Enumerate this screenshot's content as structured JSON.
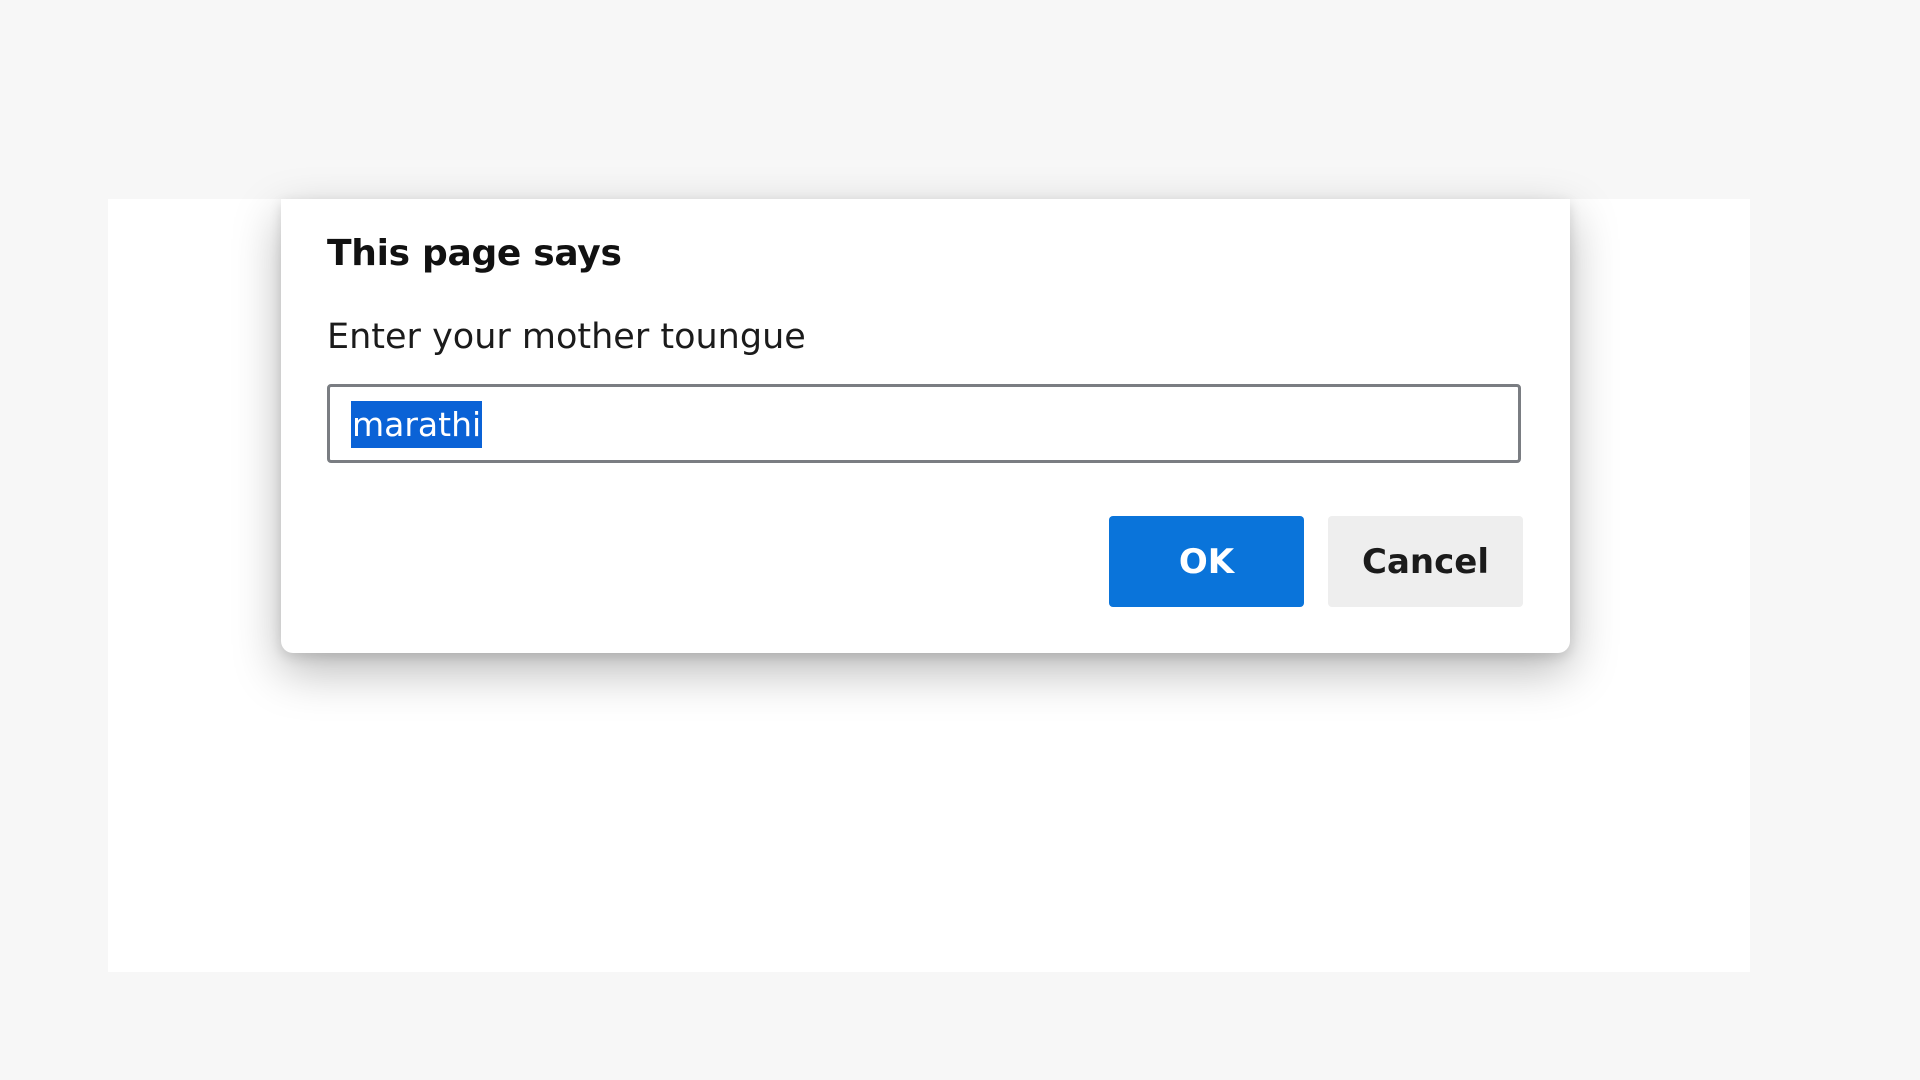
{
  "dialog": {
    "title": "This page says",
    "message": "Enter your mother toungue",
    "input_value": "marathi",
    "ok_label": "OK",
    "cancel_label": "Cancel"
  },
  "colors": {
    "accent": "#0a74da",
    "selection": "#0a62d6",
    "cancel_bg": "#eeeeee",
    "page_bg": "#f7f7f7"
  }
}
